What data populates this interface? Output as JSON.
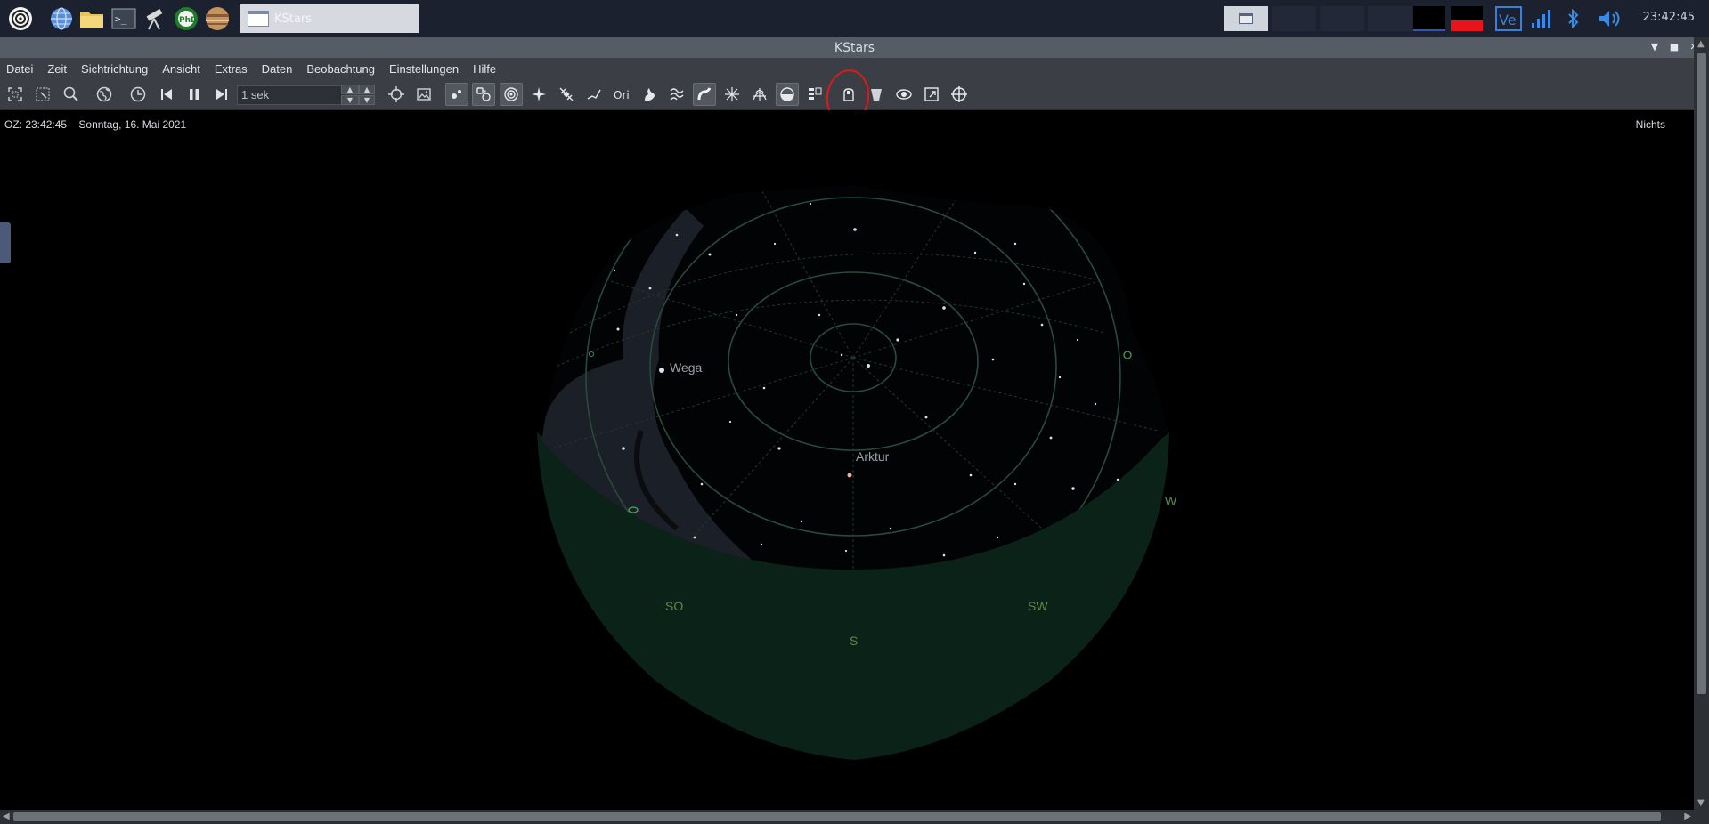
{
  "taskbar": {
    "launchers": [
      "menu-icon",
      "browser-icon",
      "file-manager-icon",
      "terminal-icon",
      "telescope-icon",
      "phd2-icon",
      "jupiter-icon"
    ],
    "task_label": "KStars",
    "clock": "23:42:45"
  },
  "window": {
    "title": "KStars"
  },
  "menubar": {
    "items": [
      "Datei",
      "Zeit",
      "Sichtrichtung",
      "Ansicht",
      "Extras",
      "Daten",
      "Beobachtung",
      "Einstellungen",
      "Hilfe"
    ]
  },
  "toolbar": {
    "speed_value": "1 sek",
    "highlighted_button": "horizon-toggle-button"
  },
  "sky": {
    "status_time": "OZ: 23:42:45",
    "status_date": "Sonntag, 16. Mai 2021",
    "focus": "Nichts",
    "star_labels": [
      "Wega",
      "Arktur"
    ],
    "horizon_labels": [
      "W",
      "SW",
      "S",
      "SO"
    ],
    "colors": {
      "ground": "#0b2218",
      "milky_way": "#1b1f27",
      "grid": "#2a4a3c",
      "label": "#5c8a4a",
      "highlight": "#e01818"
    }
  }
}
